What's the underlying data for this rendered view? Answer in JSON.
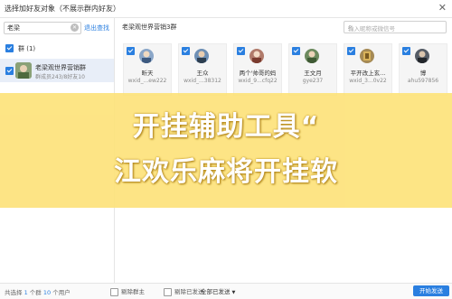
{
  "window": {
    "title": "选择加好友对象（不展示群内好友）",
    "close_icon": "close-icon"
  },
  "left": {
    "search_value": "老梁",
    "exit_search": "退出查找",
    "group_header": "群 (1)",
    "group": {
      "name": "老梁观世界营销群",
      "sub": "群成员243/8好友10"
    }
  },
  "main": {
    "group_title": "老梁观世界营销3群",
    "search_placeholder": "输入昵称或微信号",
    "members": [
      {
        "name": "昕天",
        "id": "wxid_...ew222",
        "avatar_color": "#8aa6c8"
      },
      {
        "name": "王众",
        "id": "wxid_...38312",
        "avatar_color": "#6d8fb5"
      },
      {
        "name": "两个'帅哥的妈",
        "id": "wxid_9...cfq22",
        "avatar_color": "#b07a6a"
      },
      {
        "name": "王文月",
        "id": "gye237",
        "avatar_color": "#6c8a5e"
      },
      {
        "name": "平开改上玄...",
        "id": "wxid_3...0v22",
        "avatar_color": "#a58a55"
      },
      {
        "name": "博",
        "id": "ahu597856",
        "avatar_color": "#555c66"
      }
    ]
  },
  "footer": {
    "prefix": "共选择",
    "group_count": "1",
    "group_unit": "个群",
    "user_count": "10",
    "user_unit": "个用户",
    "opt_remove_owner": "剔除群主",
    "opt_remove_sent": "剔除已发送",
    "select_value": "全部已发送",
    "start_button": "开始发送"
  },
  "overlay": {
    "line1": "开挂辅助工具“",
    "line2": "江欢乐麻将开挂软"
  },
  "colors": {
    "accent": "#2a7fe0",
    "banner": "#fde37c"
  }
}
